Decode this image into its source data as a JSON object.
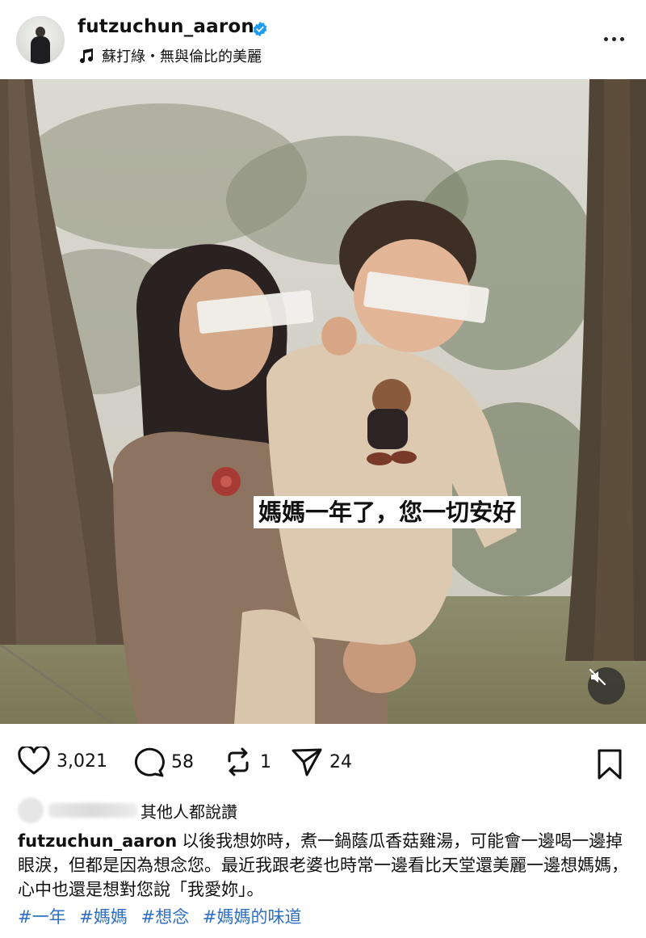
{
  "post": {
    "username": "futzuchun_aaron",
    "verified": true,
    "music": "蘇打綠・無與倫比的美麗",
    "photo_overlay_text": "媽媽一年了，您一切安好",
    "likes": "3,021",
    "comments": "58",
    "reposts": "1",
    "shares": "24",
    "liked_by_suffix": "其他人都說讚",
    "caption": "以後我想妳時，煮一鍋蔭瓜香菇雞湯，可能會一邊喝一邊掉眼淚，但都是因為想念您。最近我跟老婆也時常一邊看比天堂還美麗一邊想媽媽，心中也還是想對您說「我愛妳」。",
    "hashtags": [
      "#一年",
      "#媽媽",
      "#想念",
      "#媽媽的味道"
    ]
  },
  "colors": {
    "verified_badge": "#1d9bf0",
    "hashtag": "#2f6fc4"
  },
  "icons": [
    "music-note-icon",
    "verified-badge-icon",
    "more-options-icon",
    "heart-icon",
    "comment-icon",
    "repost-icon",
    "send-icon",
    "bookmark-icon",
    "mute-icon"
  ]
}
